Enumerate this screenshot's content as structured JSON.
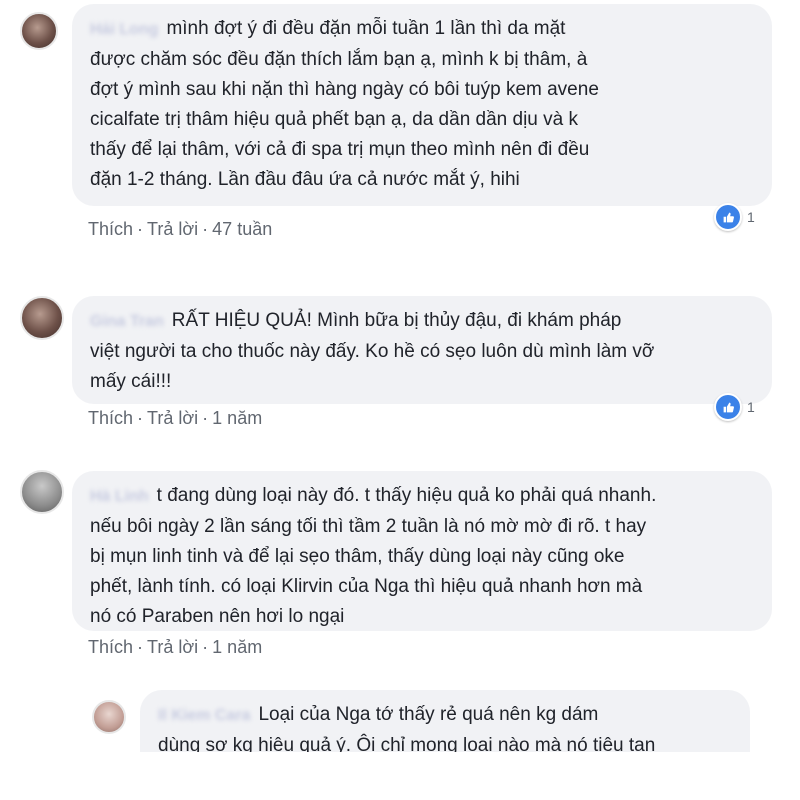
{
  "comments": [
    {
      "author": "Hải Long",
      "lines": [
        "mình đợt ý đi đều đặn mỗi tuần 1 lần thì da mặt",
        "được chăm sóc đều đặn thích lắm bạn ạ, mình k bị thâm, à",
        "đợt ý mình sau khi nặn thì hàng ngày có bôi tuýp kem avene",
        "cicalfate trị thâm hiệu quả phết bạn ạ, da dần dần dịu và k",
        "thấy để lại thâm, với cả đi spa trị mụn theo mình nên đi đều",
        "đặn 1-2 tháng. Lần đầu đâu ứa cả nước mắt ý, hihi"
      ],
      "actions": {
        "like": "Thích",
        "reply": "Trả lời",
        "time": "47 tuần"
      },
      "reaction_count": "1"
    },
    {
      "author": "Gina Tran",
      "lines": [
        "RẤT HIỆU QUẢ! Mình bữa bị thủy đậu, đi khám pháp",
        "việt người ta cho thuốc này đấy. Ko hề có sẹo luôn dù mình làm vỡ",
        "mấy cái!!!"
      ],
      "actions": {
        "like": "Thích",
        "reply": "Trả lời",
        "time": "1 năm"
      },
      "reaction_count": "1"
    },
    {
      "author": "Hà Linh",
      "lines": [
        "t đang dùng loại này đó. t thấy hiệu quả ko phải quá nhanh.",
        "nếu bôi ngày 2 lần sáng tối thì tầm 2 tuần là nó mờ mờ đi rõ. t hay",
        "bị mụn linh tinh và để lại sẹo thâm, thấy dùng loại này cũng oke",
        "phết, lành tính. có loại Klirvin của Nga thì hiệu quả nhanh hơn mà",
        "nó có Paraben nên hơi lo ngại"
      ],
      "actions": {
        "like": "Thích",
        "reply": "Trả lời",
        "time": "1 năm"
      }
    },
    {
      "author": "Il Kiem Cara",
      "lines": [
        "Loại của Nga tớ thấy rẻ quá nên kg dám",
        "dùng sợ kg hiệu quả ý. Ôi chỉ mong loại nào mà nó tiêu tan"
      ]
    }
  ],
  "colors": {
    "bubble": "#f1f2f5",
    "like_blue": "#3b82e8",
    "meta_text": "#616770"
  },
  "icons": {
    "reaction": "like-icon"
  }
}
